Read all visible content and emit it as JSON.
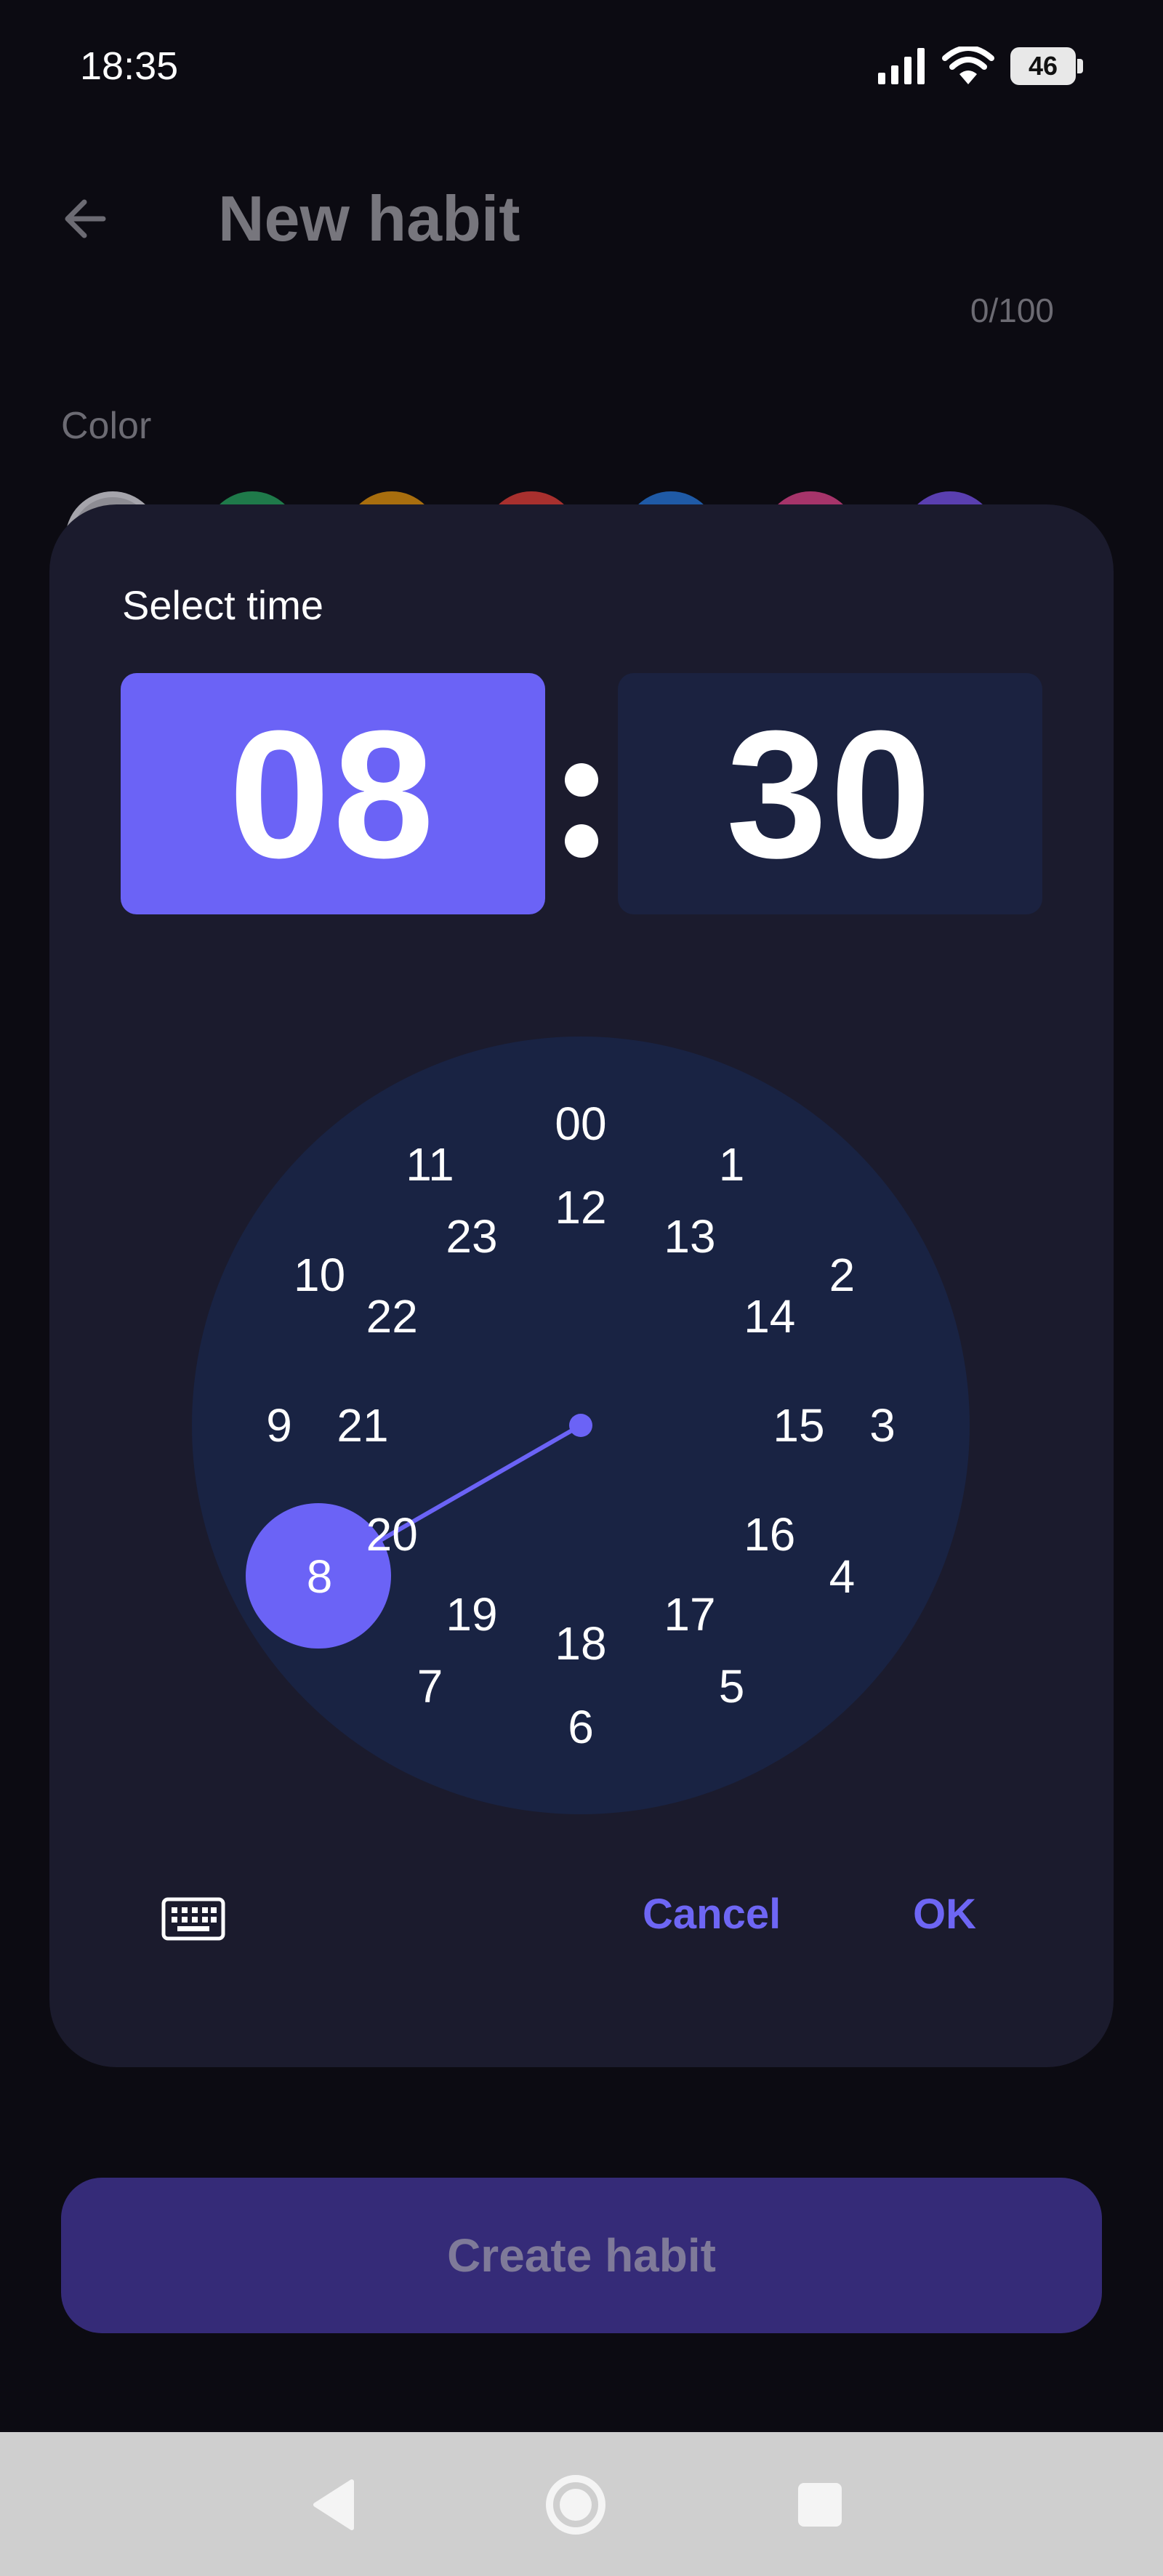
{
  "status_bar": {
    "time": "18:35",
    "battery": "46"
  },
  "page": {
    "title": "New habit",
    "counter": "0/100",
    "color_label": "Color",
    "swatch_colors": [
      "#8d8c93",
      "#1f7a4a",
      "#a86e0e",
      "#a8302e",
      "#1f5aa6",
      "#a6346a",
      "#5a3fb0"
    ],
    "create_button": "Create habit"
  },
  "dialog": {
    "title": "Select time",
    "hour": "08",
    "minute": "30",
    "selected_hour": "8",
    "clock_outer": [
      "00",
      "1",
      "2",
      "3",
      "4",
      "5",
      "6",
      "7",
      "8",
      "9",
      "10",
      "11"
    ],
    "clock_inner": [
      "12",
      "13",
      "14",
      "15",
      "16",
      "17",
      "18",
      "19",
      "20",
      "21",
      "22",
      "23"
    ],
    "cancel": "Cancel",
    "ok": "OK"
  },
  "icons": {
    "back": "back-arrow-icon",
    "keyboard": "keyboard-icon",
    "nav_back": "nav-back-icon",
    "nav_home": "nav-home-icon",
    "nav_recents": "nav-recents-icon"
  },
  "colors": {
    "accent": "#6b63f6",
    "dialog_bg": "#1b1b2d",
    "clock_bg": "#192343",
    "button_bg": "#352b78"
  }
}
